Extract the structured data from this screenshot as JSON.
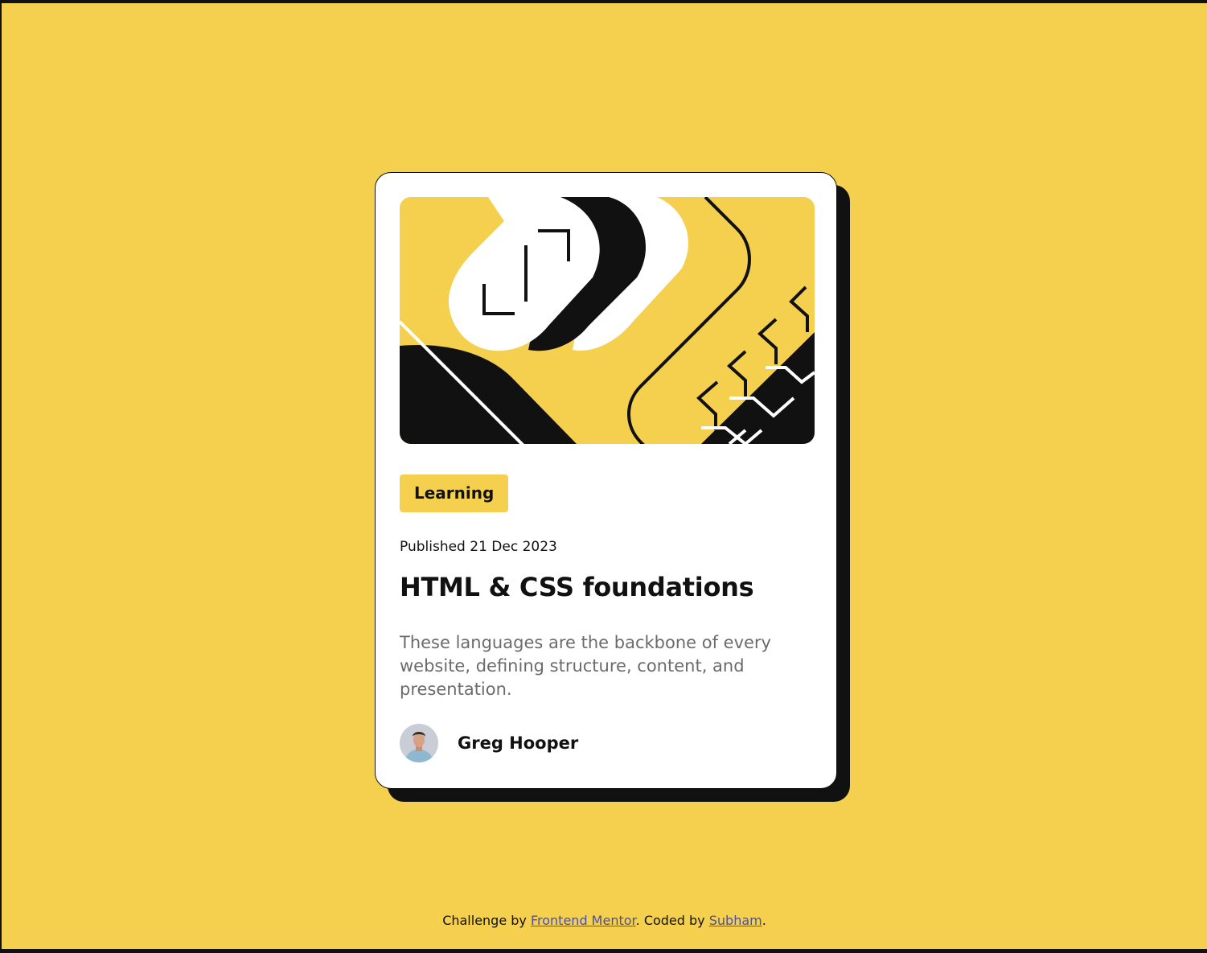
{
  "page": {
    "background_color": "#F4D04E",
    "accent_color": "#111111"
  },
  "card": {
    "illustration_icon": "html-css-illustration",
    "tag_label": "Learning",
    "published": "Published 21 Dec 2023",
    "title": "HTML & CSS foundations",
    "description": "These languages are the backbone of every website, defining structure, content, and presentation.",
    "author": {
      "name": "Greg Hooper",
      "avatar_icon": "avatar-photo"
    }
  },
  "footer": {
    "prefix": "Challenge by ",
    "link1": "Frontend Mentor",
    "middle": ". Coded by ",
    "link2": "Subham",
    "suffix": "."
  }
}
